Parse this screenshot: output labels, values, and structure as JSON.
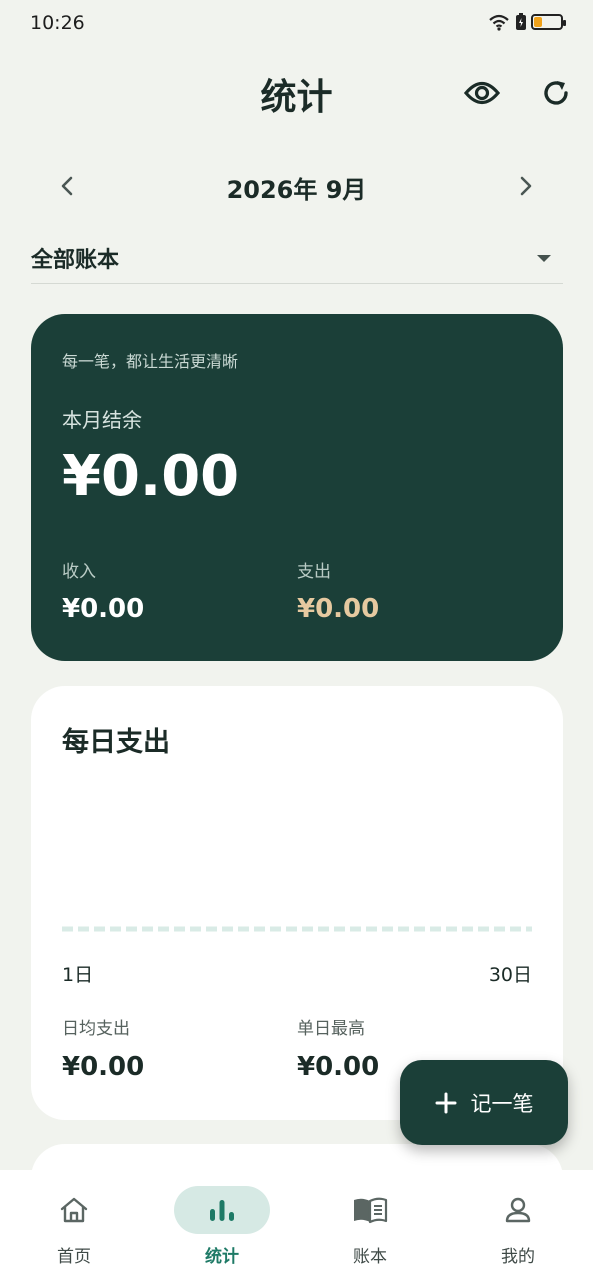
{
  "status_bar": {
    "time": "10:26",
    "battery_level": 0.3,
    "icons": [
      "wifi-icon",
      "battery-saver-icon",
      "battery-icon"
    ]
  },
  "header": {
    "title": "统计",
    "icons": [
      "eye-icon",
      "refresh-icon"
    ]
  },
  "month_nav": {
    "label": "2026年 9月",
    "icons": [
      "chevron-left-icon",
      "chevron-right-icon"
    ]
  },
  "book_select": {
    "selected": "全部账本",
    "icon": "caret-down-icon"
  },
  "summary": {
    "slogan": "每一笔，都让生活更清晰",
    "balance_label": "本月结余",
    "balance_value": "¥0.00",
    "income_label": "收入",
    "income_value": "¥0.00",
    "expense_label": "支出",
    "expense_value": "¥0.00"
  },
  "daily": {
    "title": "每日支出",
    "axis_start": "1日",
    "axis_end": "30日",
    "avg_label": "日均支出",
    "avg_value": "¥0.00",
    "max_label": "单日最高",
    "max_value": "¥0.00"
  },
  "fab": {
    "label": "记一笔",
    "icon": "plus-icon"
  },
  "bottom_nav": [
    {
      "label": "首页",
      "icon": "home-icon",
      "active": false
    },
    {
      "label": "统计",
      "icon": "bar-chart-icon",
      "active": true
    },
    {
      "label": "账本",
      "icon": "book-icon",
      "active": false
    },
    {
      "label": "我的",
      "icon": "person-icon",
      "active": false
    }
  ],
  "colors": {
    "background": "#f1f3ee",
    "card_dark": "#1b3f38",
    "expense_accent": "#e6c9a0",
    "active_nav": "#1e7a66",
    "active_nav_bg": "#d6e9e4"
  }
}
